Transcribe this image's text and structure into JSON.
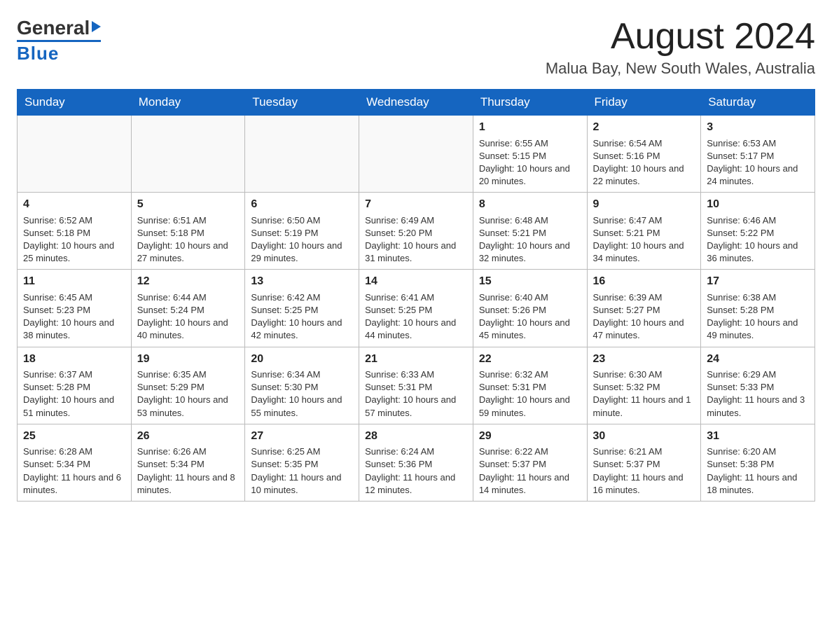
{
  "header": {
    "logo_general": "General",
    "logo_blue": "Blue",
    "month_year": "August 2024",
    "location": "Malua Bay, New South Wales, Australia"
  },
  "days_of_week": [
    "Sunday",
    "Monday",
    "Tuesday",
    "Wednesday",
    "Thursday",
    "Friday",
    "Saturday"
  ],
  "weeks": [
    [
      {
        "day": "",
        "info": ""
      },
      {
        "day": "",
        "info": ""
      },
      {
        "day": "",
        "info": ""
      },
      {
        "day": "",
        "info": ""
      },
      {
        "day": "1",
        "info": "Sunrise: 6:55 AM\nSunset: 5:15 PM\nDaylight: 10 hours and 20 minutes."
      },
      {
        "day": "2",
        "info": "Sunrise: 6:54 AM\nSunset: 5:16 PM\nDaylight: 10 hours and 22 minutes."
      },
      {
        "day": "3",
        "info": "Sunrise: 6:53 AM\nSunset: 5:17 PM\nDaylight: 10 hours and 24 minutes."
      }
    ],
    [
      {
        "day": "4",
        "info": "Sunrise: 6:52 AM\nSunset: 5:18 PM\nDaylight: 10 hours and 25 minutes."
      },
      {
        "day": "5",
        "info": "Sunrise: 6:51 AM\nSunset: 5:18 PM\nDaylight: 10 hours and 27 minutes."
      },
      {
        "day": "6",
        "info": "Sunrise: 6:50 AM\nSunset: 5:19 PM\nDaylight: 10 hours and 29 minutes."
      },
      {
        "day": "7",
        "info": "Sunrise: 6:49 AM\nSunset: 5:20 PM\nDaylight: 10 hours and 31 minutes."
      },
      {
        "day": "8",
        "info": "Sunrise: 6:48 AM\nSunset: 5:21 PM\nDaylight: 10 hours and 32 minutes."
      },
      {
        "day": "9",
        "info": "Sunrise: 6:47 AM\nSunset: 5:21 PM\nDaylight: 10 hours and 34 minutes."
      },
      {
        "day": "10",
        "info": "Sunrise: 6:46 AM\nSunset: 5:22 PM\nDaylight: 10 hours and 36 minutes."
      }
    ],
    [
      {
        "day": "11",
        "info": "Sunrise: 6:45 AM\nSunset: 5:23 PM\nDaylight: 10 hours and 38 minutes."
      },
      {
        "day": "12",
        "info": "Sunrise: 6:44 AM\nSunset: 5:24 PM\nDaylight: 10 hours and 40 minutes."
      },
      {
        "day": "13",
        "info": "Sunrise: 6:42 AM\nSunset: 5:25 PM\nDaylight: 10 hours and 42 minutes."
      },
      {
        "day": "14",
        "info": "Sunrise: 6:41 AM\nSunset: 5:25 PM\nDaylight: 10 hours and 44 minutes."
      },
      {
        "day": "15",
        "info": "Sunrise: 6:40 AM\nSunset: 5:26 PM\nDaylight: 10 hours and 45 minutes."
      },
      {
        "day": "16",
        "info": "Sunrise: 6:39 AM\nSunset: 5:27 PM\nDaylight: 10 hours and 47 minutes."
      },
      {
        "day": "17",
        "info": "Sunrise: 6:38 AM\nSunset: 5:28 PM\nDaylight: 10 hours and 49 minutes."
      }
    ],
    [
      {
        "day": "18",
        "info": "Sunrise: 6:37 AM\nSunset: 5:28 PM\nDaylight: 10 hours and 51 minutes."
      },
      {
        "day": "19",
        "info": "Sunrise: 6:35 AM\nSunset: 5:29 PM\nDaylight: 10 hours and 53 minutes."
      },
      {
        "day": "20",
        "info": "Sunrise: 6:34 AM\nSunset: 5:30 PM\nDaylight: 10 hours and 55 minutes."
      },
      {
        "day": "21",
        "info": "Sunrise: 6:33 AM\nSunset: 5:31 PM\nDaylight: 10 hours and 57 minutes."
      },
      {
        "day": "22",
        "info": "Sunrise: 6:32 AM\nSunset: 5:31 PM\nDaylight: 10 hours and 59 minutes."
      },
      {
        "day": "23",
        "info": "Sunrise: 6:30 AM\nSunset: 5:32 PM\nDaylight: 11 hours and 1 minute."
      },
      {
        "day": "24",
        "info": "Sunrise: 6:29 AM\nSunset: 5:33 PM\nDaylight: 11 hours and 3 minutes."
      }
    ],
    [
      {
        "day": "25",
        "info": "Sunrise: 6:28 AM\nSunset: 5:34 PM\nDaylight: 11 hours and 6 minutes."
      },
      {
        "day": "26",
        "info": "Sunrise: 6:26 AM\nSunset: 5:34 PM\nDaylight: 11 hours and 8 minutes."
      },
      {
        "day": "27",
        "info": "Sunrise: 6:25 AM\nSunset: 5:35 PM\nDaylight: 11 hours and 10 minutes."
      },
      {
        "day": "28",
        "info": "Sunrise: 6:24 AM\nSunset: 5:36 PM\nDaylight: 11 hours and 12 minutes."
      },
      {
        "day": "29",
        "info": "Sunrise: 6:22 AM\nSunset: 5:37 PM\nDaylight: 11 hours and 14 minutes."
      },
      {
        "day": "30",
        "info": "Sunrise: 6:21 AM\nSunset: 5:37 PM\nDaylight: 11 hours and 16 minutes."
      },
      {
        "day": "31",
        "info": "Sunrise: 6:20 AM\nSunset: 5:38 PM\nDaylight: 11 hours and 18 minutes."
      }
    ]
  ]
}
